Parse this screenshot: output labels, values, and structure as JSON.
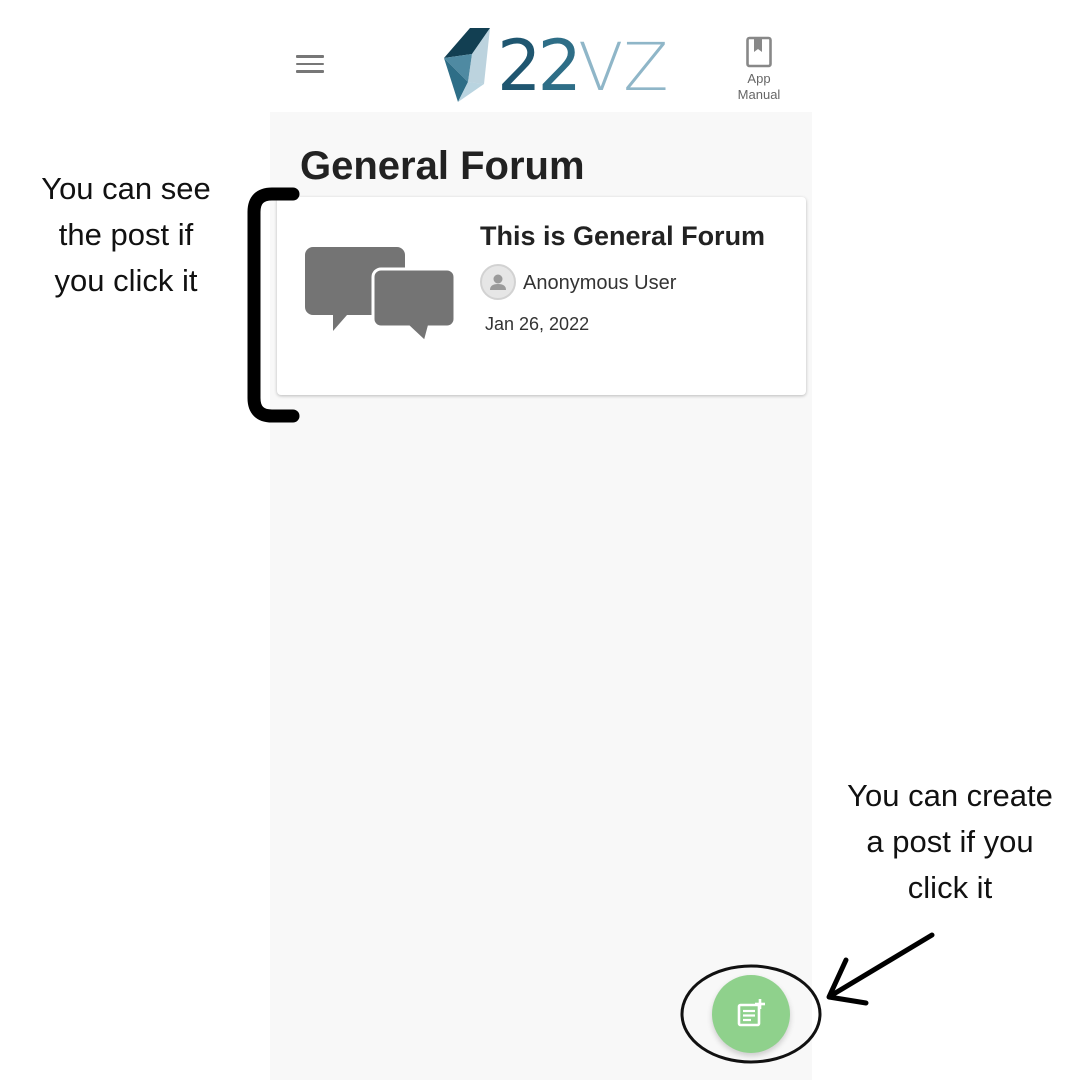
{
  "header": {
    "logo_text_a": "2",
    "logo_text_b": "2",
    "logo_text_c": "VZ",
    "menu_icon": "hamburger-menu-icon",
    "manual_icon": "book-bookmark-icon",
    "manual_label_line1": "App",
    "manual_label_line2": "Manual"
  },
  "main": {
    "title": "General Forum",
    "posts": [
      {
        "title": "This is General Forum",
        "author": "Anonymous User",
        "date": "Jan 26, 2022",
        "thumbnail_icon": "chat-bubbles-icon",
        "avatar_icon": "person-icon"
      }
    ]
  },
  "fab": {
    "icon": "create-post-icon",
    "color": "#8fd18c"
  },
  "annotations": {
    "left_line1": "You can see",
    "left_line2": "the post if",
    "left_line3": "you click it",
    "right_line1": "You can create",
    "right_line2": "a post if you",
    "right_line3": "click it"
  },
  "colors": {
    "logo_dark": "#1f5670",
    "logo_mid": "#2e6e87",
    "logo_light": "#8fb6c8",
    "background": "#f8f8f8",
    "fab": "#8fd18c"
  }
}
